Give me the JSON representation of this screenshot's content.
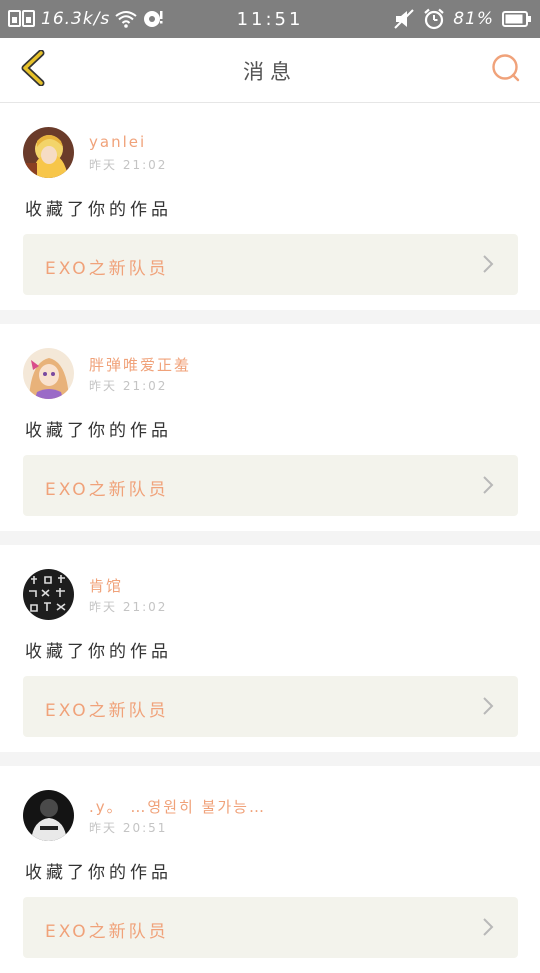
{
  "status_bar": {
    "speed": "16.3k/s",
    "time": "11:51",
    "battery": "81%",
    "icons": [
      "sim-card-icon",
      "wifi-icon",
      "sync-icon",
      "mute-icon",
      "alarm-icon",
      "battery-icon"
    ]
  },
  "header": {
    "title": "消息",
    "back_icon": "chevron-left-icon",
    "search_icon": "search-icon"
  },
  "colors": {
    "accent": "#f0a27a",
    "back_arrow": "#e6c12a",
    "link_bg": "#f3f3ec",
    "separator": "#f4f4f4"
  },
  "notifications": [
    {
      "username": "yanlei",
      "time": "昨天 21:02",
      "action": "收藏了你的作品",
      "work_title": "EXO之新队员"
    },
    {
      "username": "胖弹唯爱正羞",
      "time": "昨天 21:02",
      "action": "收藏了你的作品",
      "work_title": "EXO之新队员"
    },
    {
      "username": "肯馆",
      "time": "昨天 21:02",
      "action": "收藏了你的作品",
      "work_title": "EXO之新队员"
    },
    {
      "username": ".y。 …영원히 불가능…",
      "time": "昨天 20:51",
      "action": "收藏了你的作品",
      "work_title": "EXO之新队员"
    }
  ]
}
